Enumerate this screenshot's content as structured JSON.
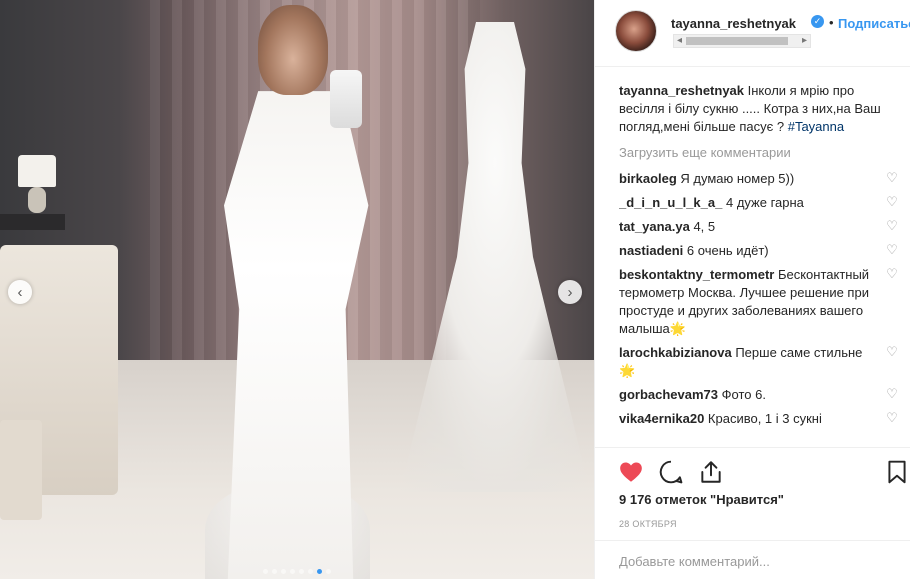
{
  "post": {
    "carousel": {
      "dot_count": 8,
      "active_index": 6,
      "prev_glyph": "‹",
      "next_glyph": "›"
    },
    "header": {
      "username": "tayanna_reshetnyak",
      "verified_glyph": "✓",
      "bullet": "•",
      "follow_label": "Подписаться",
      "scroll_left_glyph": "◂",
      "scroll_right_glyph": "▸"
    },
    "caption": {
      "username": "tayanna_reshetnyak",
      "text": " Інколи я мрію про весілля і білу сукню ..... Котра з них,на Ваш погляд,мені більше пасує ? ",
      "hashtag": "#Tayanna"
    },
    "load_more_label": "Загрузить еще комментарии",
    "comments": [
      {
        "username": "birkaoleg",
        "text": " Я думаю номер 5))"
      },
      {
        "username": "_d_i_n_u_l_k_a_",
        "text": " 4 дуже гарна"
      },
      {
        "username": "tat_yana.ya",
        "text": " 4, 5"
      },
      {
        "username": "nastiadeni",
        "text": " 6 очень идёт)"
      },
      {
        "username": "beskontaktny_termometr",
        "text": " Бесконтактный термометр Москва. Лучшее решение при простуде и других заболеваниях вашего малыша🌟"
      },
      {
        "username": "larochkabizianova",
        "text": " Перше саме стильне 🌟"
      },
      {
        "username": "gorbachevam73",
        "text": " Фото 6."
      },
      {
        "username": "vika4ernika20",
        "text": " Красиво, 1 і 3 сукні"
      }
    ],
    "comment_heart_glyph": "♡",
    "likes_text": "9 176 отметок \"Нравится\"",
    "date_text": "28 ОКТЯБРЯ",
    "add_comment_placeholder": "Добавьте комментарий...",
    "colors": {
      "like_red": "#ed4956",
      "link_blue": "#3897f0",
      "hashtag_navy": "#003569",
      "muted": "#999999"
    }
  }
}
